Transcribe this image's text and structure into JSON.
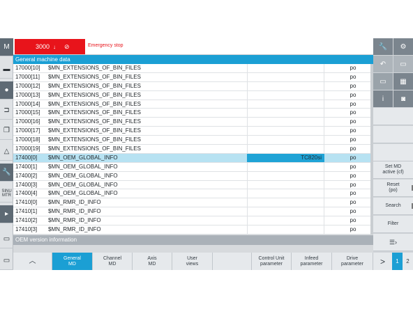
{
  "alarm": {
    "number": "3000",
    "message": "Emergency stop"
  },
  "table": {
    "title": "General machine data",
    "rows": [
      {
        "num": "17000[10]",
        "name": "$MN_EXTENSIONS_OF_BIN_FILES",
        "value": "",
        "unit": "po"
      },
      {
        "num": "17000[11]",
        "name": "$MN_EXTENSIONS_OF_BIN_FILES",
        "value": "",
        "unit": "po"
      },
      {
        "num": "17000[12]",
        "name": "$MN_EXTENSIONS_OF_BIN_FILES",
        "value": "",
        "unit": "po"
      },
      {
        "num": "17000[13]",
        "name": "$MN_EXTENSIONS_OF_BIN_FILES",
        "value": "",
        "unit": "po"
      },
      {
        "num": "17000[14]",
        "name": "$MN_EXTENSIONS_OF_BIN_FILES",
        "value": "",
        "unit": "po"
      },
      {
        "num": "17000[15]",
        "name": "$MN_EXTENSIONS_OF_BIN_FILES",
        "value": "",
        "unit": "po"
      },
      {
        "num": "17000[16]",
        "name": "$MN_EXTENSIONS_OF_BIN_FILES",
        "value": "",
        "unit": "po"
      },
      {
        "num": "17000[17]",
        "name": "$MN_EXTENSIONS_OF_BIN_FILES",
        "value": "",
        "unit": "po"
      },
      {
        "num": "17000[18]",
        "name": "$MN_EXTENSIONS_OF_BIN_FILES",
        "value": "",
        "unit": "po"
      },
      {
        "num": "17000[19]",
        "name": "$MN_EXTENSIONS_OF_BIN_FILES",
        "value": "",
        "unit": "po"
      },
      {
        "num": "17400[0]",
        "name": "$MN_OEM_GLOBAL_INFO",
        "value": "TC820si",
        "unit": "po"
      },
      {
        "num": "17400[1]",
        "name": "$MN_OEM_GLOBAL_INFO",
        "value": "",
        "unit": "po"
      },
      {
        "num": "17400[2]",
        "name": "$MN_OEM_GLOBAL_INFO",
        "value": "",
        "unit": "po"
      },
      {
        "num": "17400[3]",
        "name": "$MN_OEM_GLOBAL_INFO",
        "value": "",
        "unit": "po"
      },
      {
        "num": "17400[4]",
        "name": "$MN_OEM_GLOBAL_INFO",
        "value": "",
        "unit": "po"
      },
      {
        "num": "17410[0]",
        "name": "$MN_RMR_ID_INFO",
        "value": "",
        "unit": "po"
      },
      {
        "num": "17410[1]",
        "name": "$MN_RMR_ID_INFO",
        "value": "",
        "unit": "po"
      },
      {
        "num": "17410[2]",
        "name": "$MN_RMR_ID_INFO",
        "value": "",
        "unit": "po"
      },
      {
        "num": "17410[3]",
        "name": "$MN_RMR_ID_INFO",
        "value": "",
        "unit": "po"
      }
    ],
    "selected_index": 10,
    "footer": "OEM version information"
  },
  "left_bar": {
    "machine": "M",
    "program": "SINU\nMTR"
  },
  "right_softkeys": {
    "set_md": "Set MD\nactive (cf)",
    "reset": "Reset\n(po)",
    "search": "Search",
    "filter": "Filter",
    "info": "i"
  },
  "bottom_softkeys": {
    "up_arrow": "︿",
    "general_md": "General\nMD",
    "channel_md": "Channel\nMD",
    "axis_md": "Axis\nMD",
    "user_views": "User\nviews",
    "control_unit": "Control Unit\nparameter",
    "infeed": "Infeed\nparameter",
    "drive": "Drive\nparameter",
    "next": ">"
  },
  "pages": [
    "1",
    "2"
  ],
  "colors": {
    "accent": "#1b9fd4",
    "alarm": "#e8141b",
    "selected_row": "#b7e2f2"
  }
}
